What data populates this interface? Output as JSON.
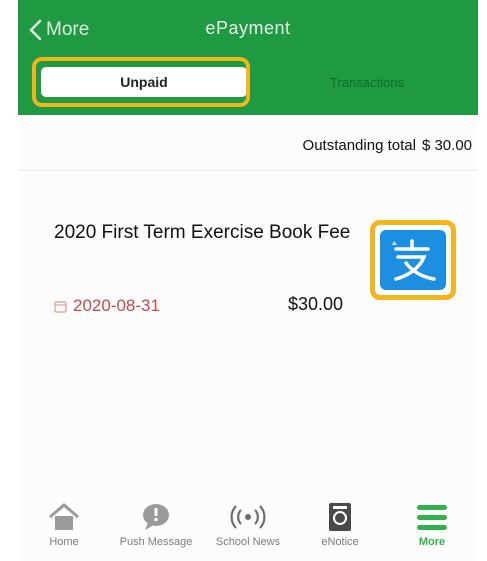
{
  "header": {
    "back_label": "More",
    "title": "ePayment"
  },
  "segments": {
    "unpaid_label": "Unpaid",
    "transactions_label": "Transactions",
    "selected": "Unpaid"
  },
  "summary": {
    "outstanding_label": "Outstanding total",
    "outstanding_amount": "$ 30.00"
  },
  "fee_item": {
    "title": "2020 First Term Exercise Book Fee",
    "due_date": "2020-08-31",
    "amount": "$30.00",
    "pay_icon": "alipay-icon"
  },
  "tabbar": {
    "items": [
      {
        "label": "Home",
        "icon": "home-icon"
      },
      {
        "label": "Push Message",
        "icon": "message-icon"
      },
      {
        "label": "School News",
        "icon": "broadcast-icon"
      },
      {
        "label": "eNotice",
        "icon": "notice-icon"
      },
      {
        "label": "More",
        "icon": "menu-icon"
      }
    ],
    "active": "More"
  },
  "colors": {
    "header_green": "#1f9a43",
    "highlight_orange": "#f3b51c",
    "due_red": "#c64a4a",
    "alipay_blue": "#1d8fe0",
    "active_tab_green": "#31b14c"
  }
}
